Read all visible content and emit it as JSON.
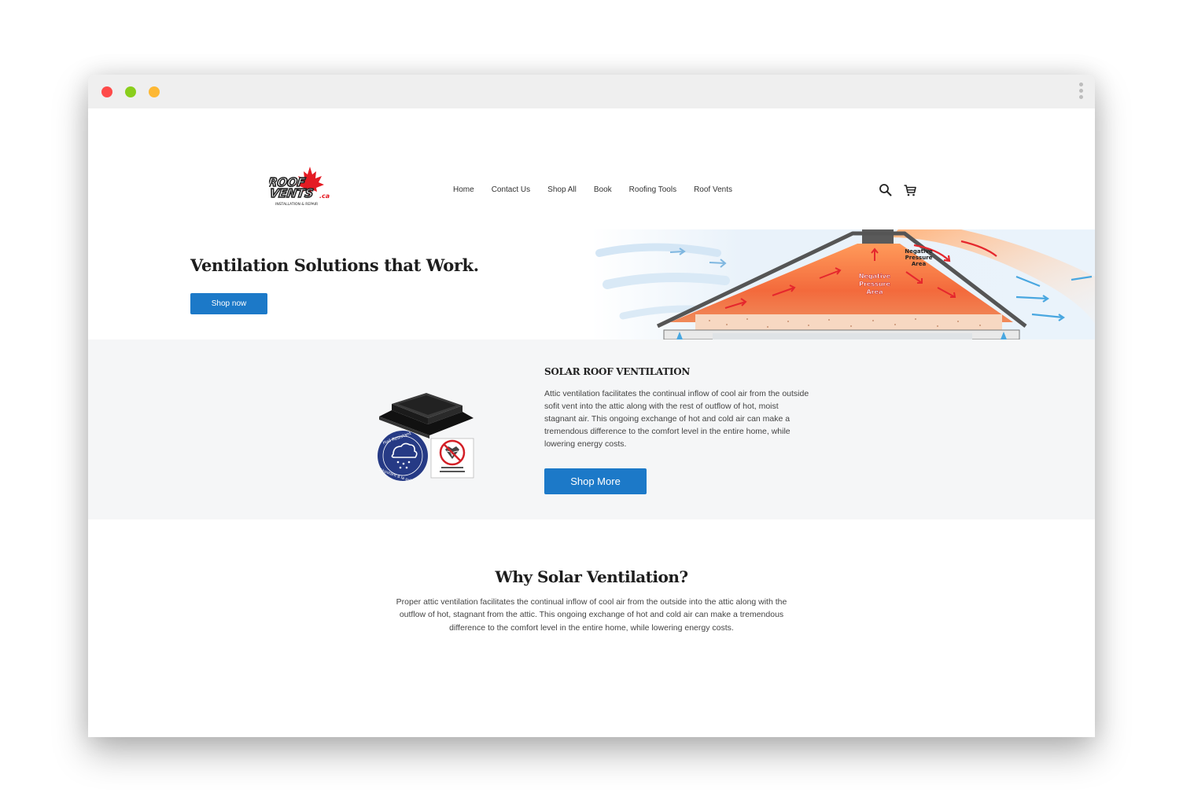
{
  "header": {
    "nav": [
      "Home",
      "Contact Us",
      "Shop All",
      "Book",
      "Roofing Tools",
      "Roof Vents"
    ],
    "logo_text": [
      "ROOF",
      "VENTS",
      ".ca",
      "INSTALLATION & REPAIR"
    ]
  },
  "hero": {
    "title": "Ventilation Solutions that Work.",
    "button": "Shop now",
    "diagram_labels": {
      "inner": [
        "Negative",
        "Pressure",
        "Area"
      ],
      "outer": [
        "Negative",
        "Pressure",
        "Area"
      ]
    }
  },
  "solar": {
    "title": "SOLAR ROOF VENTILATION",
    "body": "Attic ventilation facilitates the continual inflow of cool air from the outside sofit vent into the attic along with the rest of outflow of hot, moist stagnant air. This ongoing exchange of hot and cold air can make a tremendous difference to the comfort level in the entire home, while lowering energy costs.",
    "button": "Shop More",
    "badge_text": [
      "Hail Resistant",
      "Résistant à la grêle"
    ]
  },
  "why": {
    "title": "Why Solar Ventilation?",
    "body": "Proper attic ventilation facilitates the continual inflow of cool air from the outside into the attic along with the outflow of hot, stagnant from the attic. This ongoing exchange of hot and cold air can make a tremendous difference to the comfort level in the entire home, while lowering energy costs."
  },
  "colors": {
    "primary_button": "#1c79c8",
    "gray_section": "#f5f6f7",
    "logo_red": "#e41b23"
  }
}
